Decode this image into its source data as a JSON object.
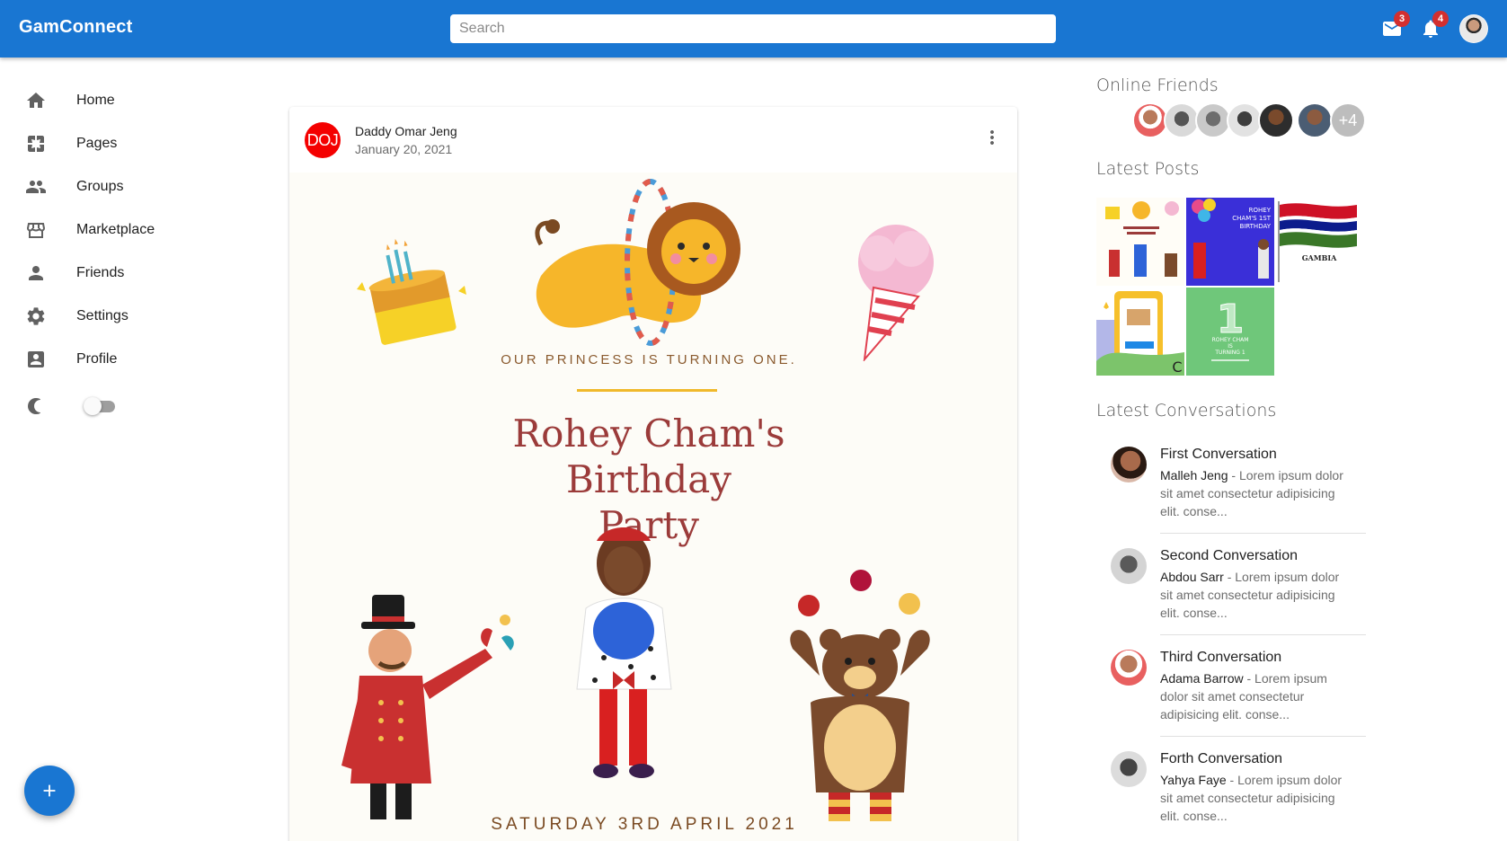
{
  "app": {
    "brand": "GamConnect"
  },
  "search": {
    "placeholder": "Search"
  },
  "header": {
    "mail_badge": "3",
    "notification_badge": "4"
  },
  "sidebar": {
    "items": [
      {
        "label": "Home",
        "icon": "home-icon"
      },
      {
        "label": "Pages",
        "icon": "pages-icon"
      },
      {
        "label": "Groups",
        "icon": "groups-icon"
      },
      {
        "label": "Marketplace",
        "icon": "storefront-icon"
      },
      {
        "label": "Friends",
        "icon": "person-icon"
      },
      {
        "label": "Settings",
        "icon": "gear-icon"
      },
      {
        "label": "Profile",
        "icon": "account-box-icon"
      }
    ],
    "dark_mode_toggle": false
  },
  "post": {
    "avatar_initials": "DOJ",
    "author": "Daddy Omar Jeng",
    "date": "January 20, 2021",
    "invitation": {
      "tagline": "OUR PRINCESS IS TURNING ONE.",
      "title_line1": "Rohey Cham's",
      "title_line2": "Birthday",
      "title_line3": "Party",
      "date": "SATURDAY 3RD APRIL 2021"
    }
  },
  "right": {
    "online_friends_heading": "Online Friends",
    "online_friends_more": "+4",
    "latest_posts_heading": "Latest Posts",
    "latest_posts": [
      {
        "caption": ""
      },
      {
        "caption": "ROHEY CHAM'S 1ST BIRTHDAY"
      },
      {
        "caption": "GAMBIA"
      },
      {
        "caption": ""
      },
      {
        "caption": "ROHEY CHAM IS TURNING 1"
      }
    ],
    "latest_conversations_heading": "Latest Conversations",
    "conversations": [
      {
        "title": "First Conversation",
        "name": "Malleh Jeng",
        "snippet": " - Lorem ipsum dolor sit amet consectetur adipisicing elit. conse..."
      },
      {
        "title": "Second Conversation",
        "name": "Abdou Sarr",
        "snippet": " - Lorem ipsum dolor sit amet consectetur adipisicing elit. conse..."
      },
      {
        "title": "Third Conversation",
        "name": "Adama Barrow",
        "snippet": " - Lorem ipsum dolor sit amet consectetur adipisicing elit. conse..."
      },
      {
        "title": "Forth Conversation",
        "name": "Yahya Faye",
        "snippet": " - Lorem ipsum dolor sit amet consectetur adipisicing elit. conse..."
      }
    ]
  },
  "colors": {
    "primary": "#1976d2",
    "badge": "#d32f2f",
    "post_avatar": "#f40000",
    "invitation_title": "#9b3b3a"
  }
}
